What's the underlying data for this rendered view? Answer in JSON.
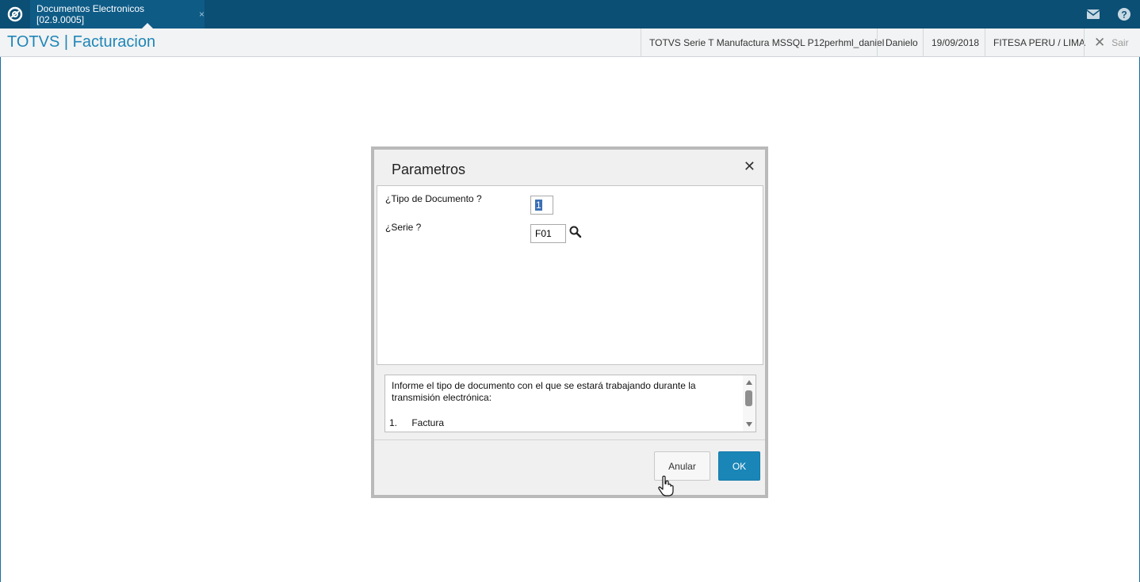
{
  "topbar": {
    "tab_label": "Documentos Electronicos [02.9.0005]",
    "tab_close": "×",
    "icons": [
      "totvs-logo-icon",
      "mail-icon",
      "help-icon"
    ]
  },
  "header": {
    "app_title": "TOTVS | Facturacion",
    "environment": "TOTVS Serie T Manufactura MSSQL P12perhml_daniel",
    "user": "Danielo",
    "date": "19/09/2018",
    "company": "FITESA PERU / LIMA",
    "exit_label": "Sair"
  },
  "dialog": {
    "title": "Parametros",
    "fields": {
      "tipo_label": "¿Tipo de Documento ?",
      "tipo_value": "1",
      "serie_label": "¿Serie ?",
      "serie_value": "F01"
    },
    "help": {
      "text": "Informe el tipo de documento con el que se estará trabajando durante la transmisión electrónica:",
      "item_number": "1.",
      "item_label": "Factura"
    },
    "cancel_label": "Anular",
    "ok_label": "OK"
  },
  "colors": {
    "topbar": "#0c4f74",
    "accent": "#1f86b7",
    "ok_button": "#1a86b8"
  }
}
